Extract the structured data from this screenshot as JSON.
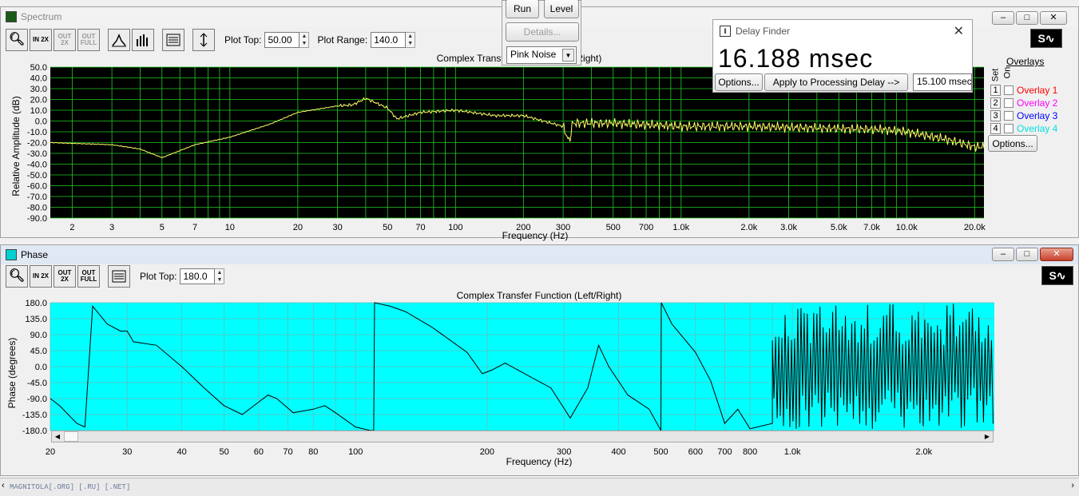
{
  "spectrum": {
    "window_title": "Spectrum",
    "plot_top_label": "Plot Top:",
    "plot_top_value": "50.00",
    "plot_range_label": "Plot Range:",
    "plot_range_value": "140.0",
    "plot_title": "Complex Transfer Function (Left/Right)",
    "ylabel": "Relative Amplitude (dB)",
    "xlabel": "Frequency (Hz)",
    "bg_color": "#000000",
    "grid_color": "#22cc22",
    "trace_color": "#ffff66",
    "y_ticks": [
      "50.0",
      "40.0",
      "30.0",
      "20.0",
      "10.0",
      "0.0",
      "-10.0",
      "-20.0",
      "-30.0",
      "-40.0",
      "-50.0",
      "-60.0",
      "-70.0",
      "-80.0",
      "-90.0"
    ],
    "x_ticks": [
      "2",
      "3",
      "5",
      "7",
      "10",
      "20",
      "30",
      "50",
      "70",
      "100",
      "200",
      "300",
      "500",
      "700",
      "1.0k",
      "2.0k",
      "3.0k",
      "5.0k",
      "7.0k",
      "10.0k",
      "20.0k"
    ],
    "toolbar_icons": [
      "zoom-icon",
      "zoom-in-2x-icon",
      "zoom-out-2x-icon",
      "zoom-out-full-icon",
      "line-graph-icon",
      "bar-graph-icon",
      "display-options-icon",
      "autoscale-icon"
    ],
    "zoom_in": "IN 2X",
    "zoom_out": "OUT 2X",
    "zoom_full": "OUT FULL"
  },
  "overlays": {
    "title": "Overlays",
    "set_label": "Set",
    "on_label": "On",
    "items": [
      {
        "num": "1",
        "label": "Overlay 1",
        "color": "#ff0000"
      },
      {
        "num": "2",
        "label": "Overlay 2",
        "color": "#ff00ff"
      },
      {
        "num": "3",
        "label": "Overlay 3",
        "color": "#0000ff"
      },
      {
        "num": "4",
        "label": "Overlay 4",
        "color": "#00e0e0"
      }
    ],
    "options_label": "Options..."
  },
  "generator": {
    "run_label": "Run",
    "level_label": "Level",
    "details_label": "Details...",
    "noise_value": "Pink Noise"
  },
  "delay_finder": {
    "title": "Delay Finder",
    "value": "16.188 msec",
    "options_label": "Options...",
    "apply_label": "Apply to Processing Delay -->",
    "processing_value": "15.100 msec"
  },
  "phase": {
    "window_title": "Phase",
    "plot_top_label": "Plot Top:",
    "plot_top_value": "180.0",
    "plot_title": "Complex Transfer Function (Left/Right)",
    "ylabel": "Phase (degrees)",
    "xlabel": "Frequency (Hz)",
    "bg_color": "#00ffff",
    "grid_color": "#66bbbb",
    "trace_color": "#000000",
    "y_ticks": [
      "180.0",
      "135.0",
      "90.0",
      "45.0",
      "0.0",
      "-45.0",
      "-90.0",
      "-135.0",
      "-180.0"
    ],
    "x_ticks": [
      "20",
      "30",
      "40",
      "50",
      "60",
      "70",
      "80",
      "100",
      "200",
      "300",
      "400",
      "500",
      "600",
      "700",
      "800",
      "1.0k",
      "2.0k"
    ]
  },
  "status": {
    "text": "MAGNITOLA[.ORG] [.RU] [.NET]"
  }
}
